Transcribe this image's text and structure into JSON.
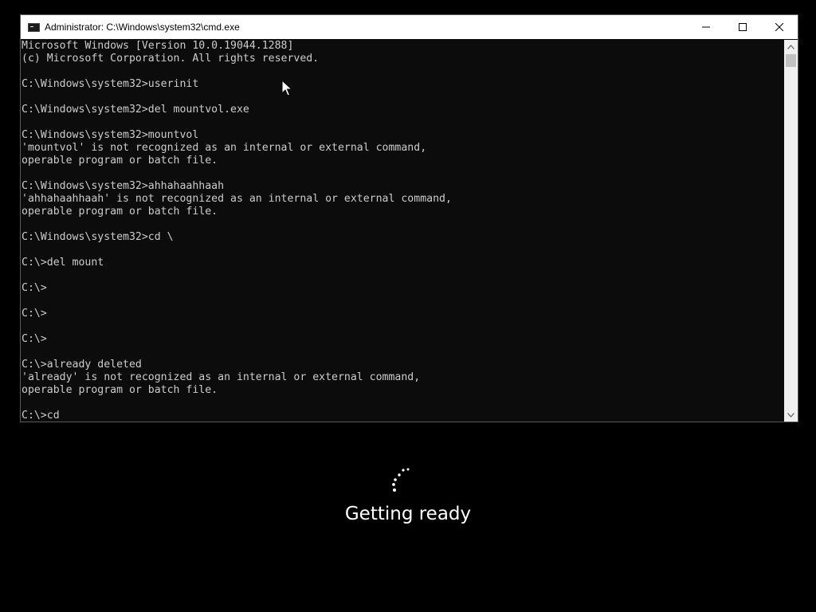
{
  "window": {
    "title": "Administrator: C:\\Windows\\system32\\cmd.exe"
  },
  "console": {
    "lines": [
      "Microsoft Windows [Version 10.0.19044.1288]",
      "(c) Microsoft Corporation. All rights reserved.",
      "",
      "C:\\Windows\\system32>userinit",
      "",
      "C:\\Windows\\system32>del mountvol.exe",
      "",
      "C:\\Windows\\system32>mountvol",
      "'mountvol' is not recognized as an internal or external command,",
      "operable program or batch file.",
      "",
      "C:\\Windows\\system32>ahhahaahhaah",
      "'ahhahaahhaah' is not recognized as an internal or external command,",
      "operable program or batch file.",
      "",
      "C:\\Windows\\system32>cd \\",
      "",
      "C:\\>del mount",
      "",
      "C:\\>",
      "",
      "C:\\>",
      "",
      "C:\\>",
      "",
      "C:\\>already deleted",
      "'already' is not recognized as an internal or external command,",
      "operable program or batch file.",
      "",
      "C:\\>cd"
    ]
  },
  "status": {
    "message": "Getting ready"
  },
  "icons": {
    "app": "cmd-app-icon",
    "minimize": "minimize-icon",
    "maximize": "maximize-icon",
    "close": "close-icon",
    "scroll_up": "chevron-up-icon",
    "scroll_down": "chevron-down-icon",
    "cursor": "mouse-pointer-icon",
    "spinner": "loading-spinner-icon"
  },
  "colors": {
    "console_bg": "#0c0c0c",
    "console_text": "#cccccc",
    "titlebar_bg": "#ffffff",
    "screen_bg": "#000000"
  }
}
